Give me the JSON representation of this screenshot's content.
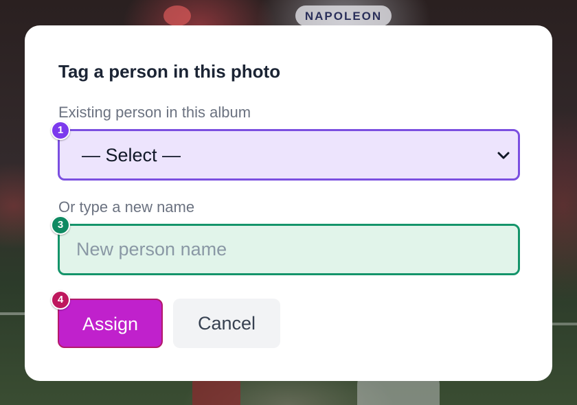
{
  "dialog": {
    "title": "Tag a person in this photo",
    "existing_label": "Existing person in this album",
    "select": {
      "selected": "— Select —"
    },
    "new_name_label": "Or type a new name",
    "new_name_input": {
      "value": "",
      "placeholder": "New person name"
    },
    "assign_label": "Assign",
    "cancel_label": "Cancel"
  },
  "badges": {
    "select": "1",
    "input": "3",
    "assign": "4"
  },
  "background": {
    "logo_text": "NAPOLEON"
  },
  "colors": {
    "select_bg": "#ede4fd",
    "select_border": "#7b4fe0",
    "input_bg": "#e1f4ea",
    "input_border": "#14946a",
    "assign_bg": "#c021cc",
    "assign_border": "#b3196a",
    "badge_select": "#7c3aed",
    "badge_input": "#0f8a62",
    "badge_assign": "#be185d"
  }
}
